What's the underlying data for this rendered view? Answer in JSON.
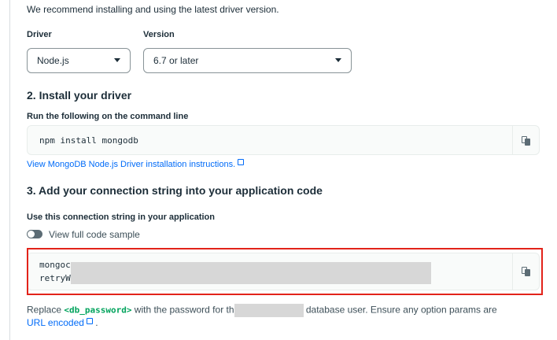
{
  "intro_text": "We recommend installing and using the latest driver version.",
  "driver": {
    "label": "Driver",
    "selected": "Node.js"
  },
  "version": {
    "label": "Version",
    "selected": "6.7 or later"
  },
  "install": {
    "title": "2. Install your driver",
    "sub_label": "Run the following on the command line",
    "command": "npm install mongodb",
    "link_text": "View MongoDB Node.js Driver installation instructions."
  },
  "connection": {
    "title": "3. Add your connection string into your application code",
    "sub_label": "Use this connection string in your application",
    "toggle_label": "View full code sample",
    "toggle_on": false,
    "code_line1": "mongoc",
    "code_line2": "retryW"
  },
  "replace_note": {
    "prefix": "Replace ",
    "placeholder": "<db_password>",
    "middle": " with the password for th",
    "suffix": " database user. Ensure any option params are",
    "link_text": "URL encoded",
    "end": " ."
  },
  "icons": [
    "chevron-down-icon",
    "copy-icon",
    "external-link-icon",
    "toggle-switch"
  ],
  "colors": {
    "link": "#016bf8",
    "placeholder_green": "#00a35c",
    "highlight_red": "#e2231a"
  }
}
